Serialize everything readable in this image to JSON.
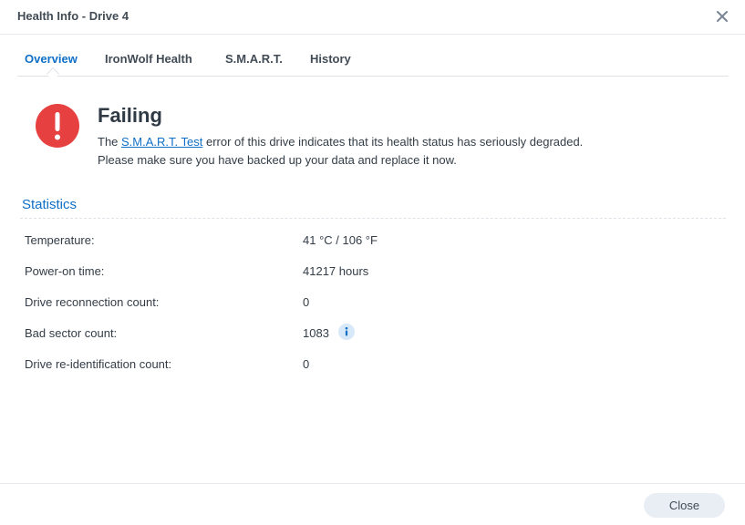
{
  "window": {
    "title": "Health Info - Drive 4"
  },
  "tabs": [
    {
      "label": "Overview",
      "active": true
    },
    {
      "label": "IronWolf Health",
      "active": false
    },
    {
      "label": "S.M.A.R.T.",
      "active": false
    },
    {
      "label": "History",
      "active": false
    }
  ],
  "status": {
    "icon": "exclamation-circle-icon",
    "color": "#e64040",
    "title": "Failing",
    "message_prefix": "The ",
    "message_link": "S.M.A.R.T. Test",
    "message_suffix": " error of this drive indicates that its health status has seriously degraded.",
    "message_line2": "Please make sure you have backed up your data and replace it now."
  },
  "statistics": {
    "title": "Statistics",
    "rows": [
      {
        "label": "Temperature:",
        "value": "41 °C / 106 °F"
      },
      {
        "label": "Power-on time:",
        "value": "41217 hours"
      },
      {
        "label": "Drive reconnection count:",
        "value": "0"
      },
      {
        "label": "Bad sector count:",
        "value": "1083",
        "info_icon": "info-icon"
      },
      {
        "label": "Drive re-identification count:",
        "value": "0"
      }
    ]
  },
  "footer": {
    "close_label": "Close"
  },
  "colors": {
    "accent": "#0f6fc6",
    "error": "#e64040",
    "button_bg": "#e9eef4"
  }
}
